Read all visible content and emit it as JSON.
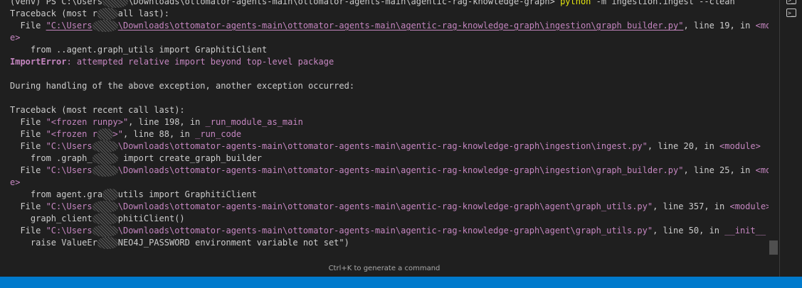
{
  "terminal": {
    "hint_text": "Ctrl+K to generate a command",
    "lines": [
      [
        {
          "text": "(venv) PS C:\\Users",
          "style": "default"
        },
        {
          "redact": 5
        },
        {
          "text": "\\Downloads\\ottomator-agents-main\\ottomator-agents-main\\agentic-rag-knowledge-graph> ",
          "style": "default"
        },
        {
          "text": "python",
          "style": "yellow"
        },
        {
          "text": " -m ingestion.ingest ",
          "style": "default"
        },
        {
          "text": "--clean",
          "style": "dim"
        }
      ],
      [
        {
          "text": "Traceback (most r",
          "style": "default"
        },
        {
          "redact": 4
        },
        {
          "text": "all last):",
          "style": "default"
        }
      ],
      [
        {
          "text": "  File ",
          "style": "default"
        },
        {
          "text": "\"C:\\Users",
          "style": "path"
        },
        {
          "redact": 5
        },
        {
          "text": "\\Downloads\\ottomator-agents-main\\ottomator-agents-main\\agentic-rag-knowledge-graph\\ingestion\\graph_builder.py\"",
          "style": "path"
        },
        {
          "text": ", line 19, in ",
          "style": "default"
        },
        {
          "text": "<modul",
          "style": "magenta"
        }
      ],
      [
        {
          "text": "e>",
          "style": "magenta"
        }
      ],
      [
        {
          "text": "    from ..agent.graph_utils import GraphitiClient",
          "style": "plain"
        }
      ],
      [
        {
          "text": "ImportError",
          "style": "error"
        },
        {
          "text": ": attempted relative import beyond top-level package",
          "style": "magenta"
        }
      ],
      [
        {
          "text": "",
          "style": "default"
        }
      ],
      [
        {
          "text": "During handling of the above exception, another exception occurred:",
          "style": "default"
        }
      ],
      [
        {
          "text": "",
          "style": "default"
        }
      ],
      [
        {
          "text": "Traceback (most recent call last):",
          "style": "default"
        }
      ],
      [
        {
          "text": "  File ",
          "style": "default"
        },
        {
          "text": "\"<frozen runpy>\"",
          "style": "path-plain"
        },
        {
          "text": ", line 198, in ",
          "style": "default"
        },
        {
          "text": "_run_module_as_main",
          "style": "magenta"
        }
      ],
      [
        {
          "text": "  File ",
          "style": "default"
        },
        {
          "text": "\"<frozen r",
          "style": "path-plain"
        },
        {
          "redact": 3
        },
        {
          "text": ">\"",
          "style": "path-plain"
        },
        {
          "text": ", line 88, in ",
          "style": "default"
        },
        {
          "text": "_run_code",
          "style": "magenta"
        }
      ],
      [
        {
          "text": "  File ",
          "style": "default"
        },
        {
          "text": "\"C:\\Users",
          "style": "path-plain"
        },
        {
          "redact": 5
        },
        {
          "text": "\\Downloads\\ottomator-agents-main\\ottomator-agents-main\\agentic-rag-knowledge-graph\\ingestion\\ingest.py\"",
          "style": "path-plain"
        },
        {
          "text": ", line 20, in ",
          "style": "default"
        },
        {
          "text": "<module>",
          "style": "magenta"
        }
      ],
      [
        {
          "text": "    from .graph_",
          "style": "plain"
        },
        {
          "redact": 5
        },
        {
          "text": " import create_graph_builder",
          "style": "plain"
        }
      ],
      [
        {
          "text": "  File ",
          "style": "default"
        },
        {
          "text": "\"C:\\Users",
          "style": "path-plain"
        },
        {
          "redact": 5
        },
        {
          "text": "\\Downloads\\ottomator-agents-main\\ottomator-agents-main\\agentic-rag-knowledge-graph\\ingestion\\graph_builder.py\"",
          "style": "path-plain"
        },
        {
          "text": ", line 25, in ",
          "style": "default"
        },
        {
          "text": "<modul",
          "style": "magenta"
        }
      ],
      [
        {
          "text": "e>",
          "style": "magenta"
        }
      ],
      [
        {
          "text": "    from agent.gra",
          "style": "plain"
        },
        {
          "redact": 3
        },
        {
          "text": "utils import GraphitiClient",
          "style": "plain"
        }
      ],
      [
        {
          "text": "  File ",
          "style": "default"
        },
        {
          "text": "\"C:\\Users",
          "style": "path-plain"
        },
        {
          "redact": 5
        },
        {
          "text": "\\Downloads\\ottomator-agents-main\\ottomator-agents-main\\agentic-rag-knowledge-graph\\agent\\graph_utils.py\"",
          "style": "path-plain"
        },
        {
          "text": ", line 357, in ",
          "style": "default"
        },
        {
          "text": "<module>",
          "style": "magenta"
        }
      ],
      [
        {
          "text": "    graph_client",
          "style": "plain"
        },
        {
          "redact": 5
        },
        {
          "text": "phitiClient()",
          "style": "plain"
        }
      ],
      [
        {
          "text": "  File ",
          "style": "default"
        },
        {
          "text": "\"C:\\Users",
          "style": "path-plain"
        },
        {
          "redact": 5
        },
        {
          "text": "\\Downloads\\ottomator-agents-main\\ottomator-agents-main\\agentic-rag-knowledge-graph\\agent\\graph_utils.py\"",
          "style": "path-plain"
        },
        {
          "text": ", line 50, in ",
          "style": "default"
        },
        {
          "text": "__init__",
          "style": "magenta"
        }
      ],
      [
        {
          "text": "    raise ValueEr",
          "style": "plain"
        },
        {
          "redact": 4
        },
        {
          "text": "NEO4J_PASSWORD environment variable not set\")",
          "style": "plain"
        }
      ]
    ]
  },
  "side_panel": {
    "icons": [
      "terminal-tab-icon",
      "terminal-tab-icon"
    ]
  },
  "colors": {
    "background": "#1f1f1f",
    "status_bar": "#007acc",
    "path": "#c586c0",
    "command": "#e5e510"
  }
}
